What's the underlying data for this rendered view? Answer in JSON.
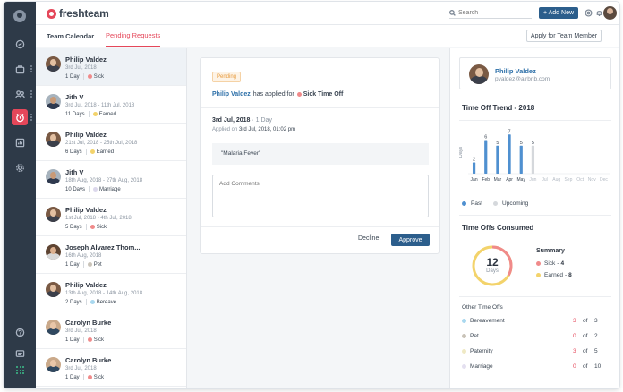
{
  "brand": {
    "name": "freshteam",
    "color": "#e5475a"
  },
  "header": {
    "search_placeholder": "Search",
    "add_new_label": "+ Add New",
    "icons": [
      "help-icon",
      "bell-icon"
    ]
  },
  "tabs": [
    {
      "label": "Team Calendar",
      "active": false
    },
    {
      "label": "Pending Requests",
      "active": true
    }
  ],
  "apply_button": "Apply for Team Member",
  "sidebar": {
    "icons": [
      "home-icon",
      "briefcase-icon",
      "team-icon",
      "timeoff-icon",
      "reports-icon",
      "settings-icon",
      "help-icon",
      "chat-icon",
      "apps-icon"
    ],
    "active": "timeoff-icon"
  },
  "requests": [
    {
      "name": "Philip Valdez",
      "date": "3rd Jul, 2018",
      "days": "1 Day",
      "type": "Sick",
      "type_color": "#f08a8a",
      "selected": true
    },
    {
      "name": "Jith V",
      "date": "3rd Jul, 2018 - 11th Jul, 2018",
      "days": "11 Days",
      "type": "Earned",
      "type_color": "#f3d36b"
    },
    {
      "name": "Philip Valdez",
      "date": "21st Jul, 2018 - 25th Jul, 2018",
      "days": "6 Days",
      "type": "Earned",
      "type_color": "#f3d36b"
    },
    {
      "name": "Jith V",
      "date": "18th Aug, 2018 - 27th Aug, 2018",
      "days": "10 Days",
      "type": "Marriage",
      "type_color": "#dcd8ec"
    },
    {
      "name": "Philip Valdez",
      "date": "1st Jul, 2018 - 4th Jul, 2018",
      "days": "5 Days",
      "type": "Sick",
      "type_color": "#f08a8a"
    },
    {
      "name": "Joseph Alvarez Thom...",
      "date": "16th Aug, 2018",
      "days": "1 Day",
      "type": "Pet",
      "type_color": "#c9c3b8"
    },
    {
      "name": "Philip Valdez",
      "date": "13th Aug, 2018 - 14th Aug, 2018",
      "days": "2 Days",
      "type": "Bereave...",
      "type_color": "#a9d8ef"
    },
    {
      "name": "Carolyn Burke",
      "date": "3rd Jul, 2018",
      "days": "1 Day",
      "type": "Sick",
      "type_color": "#f08a8a"
    },
    {
      "name": "Carolyn Burke",
      "date": "3rd Jul, 2018",
      "days": "1 Day",
      "type": "Sick",
      "type_color": "#f08a8a"
    }
  ],
  "detail": {
    "status": "Pending",
    "requester": "Philip Valdez",
    "has_applied_for": "has applied for",
    "leave_type": "Sick Time Off",
    "date": "3rd Jul, 2018",
    "duration": "1 Day",
    "applied_on_prefix": "Applied on",
    "applied_on": "3rd Jul, 2018, 01:02 pm",
    "reason": "\"Malaria Fever\"",
    "comments_placeholder": "Add Comments",
    "decline_label": "Decline",
    "approve_label": "Approve"
  },
  "profile": {
    "name": "Philip Valdez",
    "email": "pvaldez@airbnb.com"
  },
  "trend_title": "Time Off Trend - 2018",
  "chart_data": {
    "type": "bar",
    "ylabel": "Days",
    "categories": [
      "Jan",
      "Feb",
      "Mar",
      "Apr",
      "May",
      "Jun",
      "Jul",
      "Aug",
      "Sep",
      "Oct",
      "Nov",
      "Dec"
    ],
    "series": [
      {
        "name": "Past",
        "color": "#4f90d0",
        "values": [
          2,
          6,
          5,
          7,
          5,
          0,
          0,
          0,
          0,
          0,
          0,
          0
        ]
      },
      {
        "name": "Upcoming",
        "color": "#d5d8dc",
        "values": [
          0,
          0,
          0,
          0,
          0,
          5,
          0,
          0,
          0,
          0,
          0,
          0
        ]
      }
    ],
    "ylim": [
      0,
      8
    ]
  },
  "legend": [
    {
      "label": "Past",
      "color": "#4f90d0"
    },
    {
      "label": "Upcoming",
      "color": "#d5d8dc"
    }
  ],
  "consumed": {
    "title": "Time Offs Consumed",
    "total": "12",
    "unit": "Days",
    "summary_title": "Summary",
    "summary": [
      {
        "label": "Sick",
        "value": "4",
        "color": "#f08a8a"
      },
      {
        "label": "Earned",
        "value": "8",
        "color": "#f3d36b"
      }
    ]
  },
  "other": {
    "title": "Other Time Offs",
    "of_word": "of",
    "rows": [
      {
        "label": "Bereavement",
        "taken": "3",
        "total": "3",
        "color": "#a9d8ef"
      },
      {
        "label": "Pet",
        "taken": "0",
        "total": "2",
        "color": "#c9c3b8"
      },
      {
        "label": "Paternity",
        "taken": "3",
        "total": "5",
        "color": "#efe9c4"
      },
      {
        "label": "Marriage",
        "taken": "0",
        "total": "10",
        "color": "#e4e0f0"
      }
    ]
  }
}
